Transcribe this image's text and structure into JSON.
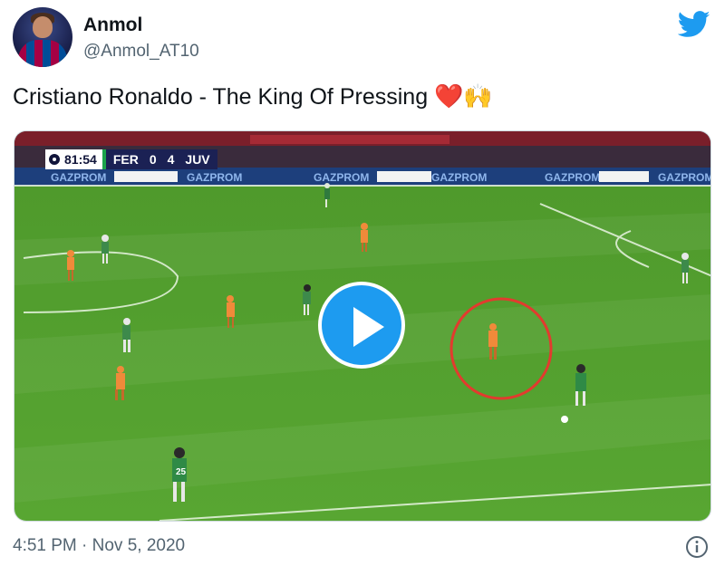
{
  "author": {
    "name": "Anmol",
    "handle": "@Anmol_AT10",
    "avatar_icon": "player-avatar",
    "brand_icon": "twitter-bird-icon",
    "brand_color": "#1d9bf0"
  },
  "tweet": {
    "text": "Cristiano Ronaldo - The King Of Pressing",
    "emojis": "❤️🙌",
    "timestamp": "4:51 PM · Nov 5, 2020"
  },
  "video": {
    "scoreboard": {
      "clock": "81:54",
      "home_team": "FER",
      "home_score": "0",
      "away_score": "4",
      "away_team": "JUV"
    },
    "sponsor": "GAZPROM",
    "shirt_number": "25",
    "play_icon": "play-icon",
    "highlight_color": "#e23b2e"
  }
}
